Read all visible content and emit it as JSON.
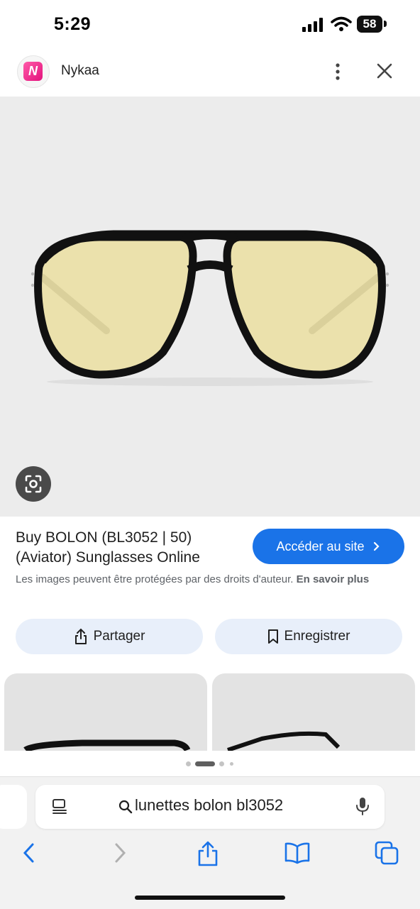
{
  "status_bar": {
    "time": "5:29",
    "battery": "58"
  },
  "site": {
    "name": "Nykaa",
    "logo_letter": "N"
  },
  "result": {
    "title": "Buy BOLON (BL3052 | 50) (Aviator) Sunglasses Online",
    "visit_button": "Accéder au site",
    "copyright_text": "Les images peuvent être protégées par des droits d'auteur.",
    "learn_more": "En savoir plus"
  },
  "actions": {
    "share_label": "Partager",
    "save_label": "Enregistrer"
  },
  "browser": {
    "address": "lunettes bolon bl3052"
  },
  "colors": {
    "accent": "#1a73e8",
    "pill_bg": "#e8effa",
    "hero_bg": "#ececec",
    "brand_pink": "#e3127d"
  },
  "icons": [
    "signal-icon",
    "wifi-icon",
    "more-vert-icon",
    "close-icon",
    "google-lens-icon",
    "chevron-right-icon",
    "share-icon",
    "bookmark-icon",
    "reader-icon",
    "search-icon",
    "mic-icon",
    "back-icon",
    "forward-icon",
    "share-sheet-icon",
    "bookmarks-icon",
    "tabs-icon"
  ]
}
